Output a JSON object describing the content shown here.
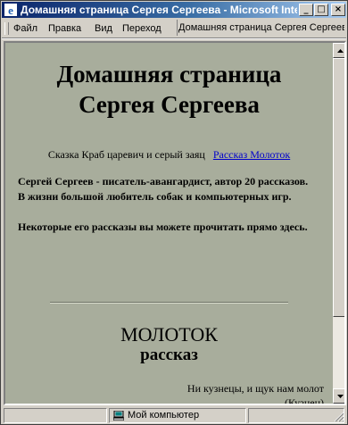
{
  "window": {
    "title": "Домашняя страница Сергея Сергеева - Microsoft Internet...",
    "minimize": "_",
    "maximize": "□",
    "close": "×"
  },
  "menu": {
    "file": "Файл",
    "edit": "Правка",
    "view": "Вид",
    "go": "Переход"
  },
  "address": {
    "text": "Домашняя страница Сергея Сергеева - Mi"
  },
  "page": {
    "heading_line1": "Домашняя страница",
    "heading_line2": "Сергея Сергеева",
    "nav_text": "Сказка Краб царевич и серый заяц",
    "nav_link": "Рассказ Молоток",
    "intro_line1": "Сергей Сергеев - писатель-авангардист, автор 20 рассказов.",
    "intro_line2": "В жизни большой любитель собак и компьютерных игр.",
    "intro_line3": "Некоторые его рассказы вы можете прочитать прямо здесь.",
    "story_title": "МОЛОТОК",
    "story_subtitle": "рассказ",
    "epigraph_line1": "Ни кузнецы, и щук нам молот",
    "epigraph_line2": "(Кузнец)"
  },
  "status": {
    "zone": "Мой компьютер"
  },
  "colors": {
    "page_bg": "#a8ad9c",
    "title_bar": "#0a246a",
    "link": "#0000cc"
  }
}
